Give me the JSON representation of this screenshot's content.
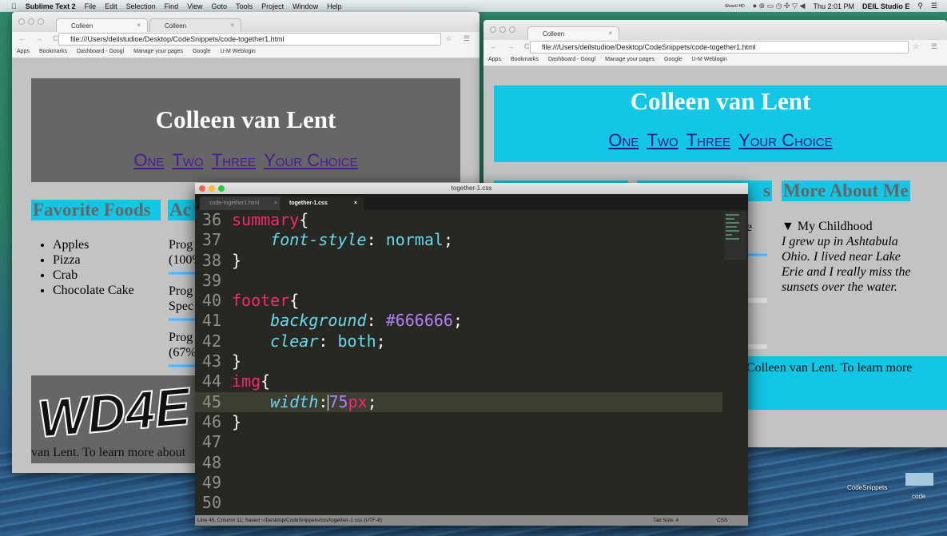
{
  "menubar": {
    "app": "Sublime Text 2",
    "items": [
      "File",
      "Edit",
      "Selection",
      "Find",
      "View",
      "Goto",
      "Tools",
      "Project",
      "Window",
      "Help"
    ],
    "clock": "Thu 2:01 PM",
    "user": "DEIL Studio E",
    "recording": "ShowU HD"
  },
  "browser_left": {
    "tabs": [
      "Colleen",
      "Colleen"
    ],
    "url": "file:///Users/deilstudioe/Desktop/CodeSnippets/code-together1.html",
    "bookmarks": [
      "Apps",
      "Bookmarks",
      "Dashboard - Googl",
      "Manage your pages",
      "Google",
      "U-M Weblogin"
    ],
    "page": {
      "title": "Colleen van Lent",
      "nav": [
        "One",
        "Two",
        "Three",
        "Your Choice"
      ],
      "sections": [
        "Favorite Foods",
        "Ac"
      ],
      "foods": [
        "Apples",
        "Pizza",
        "Crab",
        "Chocolate Cake"
      ],
      "progress": [
        {
          "l1": "Prog",
          "l2": "(100%"
        },
        {
          "l1": "Prog",
          "l2": "Spec"
        },
        {
          "l1": "Prog",
          "l2": "(67%"
        }
      ],
      "logo": "WD4E",
      "footer": "van Lent. To learn more about",
      "header_color": "#666666"
    }
  },
  "browser_right": {
    "tabs": [
      "Colleen"
    ],
    "url": "file:///Users/deilstudioe/Desktop/CodeSnippets/code-together1.html",
    "bookmarks": [
      "Apps",
      "Bookmarks",
      "Dashboard - Googl",
      "Manage your pages",
      "Google",
      "U-M Weblogin"
    ],
    "page": {
      "title": "Colleen van Lent",
      "nav": [
        "One",
        "Two",
        "Three",
        "Your Choice"
      ],
      "sections": [
        "",
        "s",
        "More About Me"
      ],
      "partial": "e",
      "summary": "My Childhood",
      "details": "I grew up in Ashtabula Ohio. I lived near Lake Erie and I really miss the sunsets over the water.",
      "footer": "Colleen van Lent. To learn more",
      "accent": "#13c6e6"
    }
  },
  "editor": {
    "title": "together-1.css",
    "tabs": [
      "code-together1.html",
      "together-1.css"
    ],
    "active_tab": 1,
    "lines": [
      {
        "n": "36",
        "tokens": [
          [
            "k",
            "summary"
          ],
          [
            "b",
            "{"
          ]
        ]
      },
      {
        "n": "37",
        "tokens": [
          [
            "b",
            "    "
          ],
          [
            "p",
            "font-style"
          ],
          [
            "b",
            ": "
          ],
          [
            "v",
            "normal"
          ],
          [
            "b",
            ";"
          ]
        ]
      },
      {
        "n": "38",
        "tokens": [
          [
            "b",
            "}"
          ]
        ]
      },
      {
        "n": "39",
        "tokens": []
      },
      {
        "n": "40",
        "tokens": [
          [
            "k",
            "footer"
          ],
          [
            "b",
            "{"
          ]
        ]
      },
      {
        "n": "41",
        "tokens": [
          [
            "b",
            "    "
          ],
          [
            "p",
            "background"
          ],
          [
            "b",
            ": "
          ],
          [
            "n",
            "#666666"
          ],
          [
            "b",
            ";"
          ]
        ]
      },
      {
        "n": "42",
        "tokens": [
          [
            "b",
            "    "
          ],
          [
            "p",
            "clear"
          ],
          [
            "b",
            ": "
          ],
          [
            "v",
            "both"
          ],
          [
            "b",
            ";"
          ]
        ]
      },
      {
        "n": "43",
        "tokens": [
          [
            "b",
            "}"
          ]
        ]
      },
      {
        "n": "44",
        "tokens": [
          [
            "k",
            "img"
          ],
          [
            "b",
            "{"
          ]
        ]
      },
      {
        "n": "45",
        "current": true,
        "tokens": [
          [
            "b",
            "    "
          ],
          [
            "p",
            "width"
          ],
          [
            "b",
            ":"
          ],
          [
            "caret",
            ""
          ],
          [
            "n",
            "75"
          ],
          [
            "u",
            "px"
          ],
          [
            "b",
            ";"
          ]
        ]
      },
      {
        "n": "46",
        "tokens": [
          [
            "b",
            "}"
          ]
        ]
      },
      {
        "n": "47",
        "tokens": []
      },
      {
        "n": "48",
        "tokens": []
      },
      {
        "n": "49",
        "tokens": []
      },
      {
        "n": "50",
        "tokens": []
      }
    ],
    "status": "Line 45, Column 11; Saved ~/Desktop/CodeSnippets/css/together-1.css (UTF-8)",
    "tab_size": "Tab Size: 4",
    "syntax": "CSS"
  },
  "desktop": {
    "icons": [
      "CodeSnippets",
      "code"
    ]
  }
}
